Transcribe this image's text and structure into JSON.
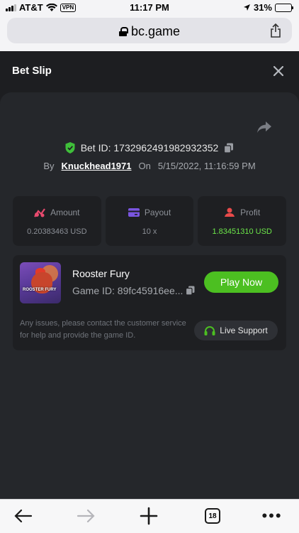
{
  "status_bar": {
    "carrier": "AT&T",
    "vpn": "VPN",
    "time": "11:17 PM",
    "battery": "31%",
    "battery_level": 0.31
  },
  "browser": {
    "url": "bc.game",
    "tabs_count": "18"
  },
  "modal": {
    "title": "Bet Slip",
    "bet_id_label": "Bet ID: 1732962491982932352",
    "by_label": "By",
    "username": "Knuckhead1971",
    "on_label": "On",
    "date": "5/15/2022, 11:16:59 PM"
  },
  "stats": [
    {
      "label": "Amount",
      "value": "0.20383463 USD",
      "icon": "amount-icon"
    },
    {
      "label": "Payout",
      "value": "10 x",
      "icon": "payout-icon"
    },
    {
      "label": "Profit",
      "value": "1.83451310 USD",
      "icon": "profit-icon"
    }
  ],
  "game": {
    "name": "Rooster Fury",
    "game_id": "Game ID: 89fc45916ee...",
    "thumb_text": "ROOSTER FURY",
    "play_label": "Play Now",
    "help_text": "Any issues, please contact the customer service for help and provide the game ID.",
    "support_label": "Live Support"
  },
  "colors": {
    "accent_green": "#4cbf21",
    "profit_green": "#6ce64a",
    "background": "#1d1e21",
    "card": "#25272b"
  }
}
